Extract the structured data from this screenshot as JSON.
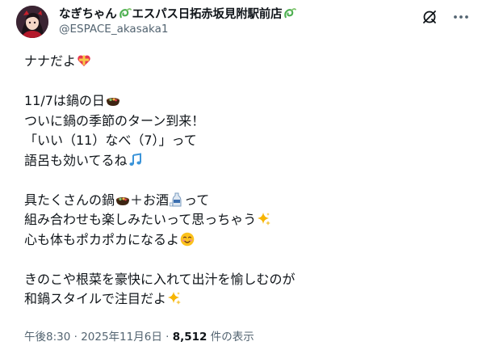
{
  "author": {
    "display_name": "なぎちゃん",
    "display_name_suffix": "エスパス日拓赤坂見附駅前店",
    "handle": "@ESPACE_akasaka1",
    "name_emoji": "seedling-swirl"
  },
  "post": {
    "lines": [
      {
        "text": "ナナだよ",
        "emoji": "heart-ribbon"
      },
      {
        "text": "",
        "emoji": ""
      },
      {
        "text": "11/7は鍋の日",
        "emoji": "hotpot"
      },
      {
        "text": "ついに鍋の季節のターン到来！",
        "emoji": ""
      },
      {
        "text": "「いい（11）なべ（7）」って",
        "emoji": ""
      },
      {
        "text": "語呂も効いてるね",
        "emoji": "music-notes"
      },
      {
        "text": "",
        "emoji": ""
      },
      {
        "text": "具たくさんの鍋",
        "emoji": "hotpot"
      },
      {
        "text": "組み合わせも楽しみたいって思っちゃう",
        "emoji": "sparkles"
      },
      {
        "text": "心も体もポカポカになるよ",
        "emoji": "smiling-face"
      },
      {
        "text": "",
        "emoji": ""
      },
      {
        "text": "きのこや根菜を豪快に入れて出汁を愉しむのが",
        "emoji": ""
      },
      {
        "text": "和鍋スタイルで注目だよ",
        "emoji": "sparkles"
      }
    ],
    "line7_mid_text": "＋お酒",
    "line7_end_text": "って"
  },
  "meta": {
    "time": "午後8:30",
    "sep1": " · ",
    "date": "2025年11月6日",
    "sep2": " · ",
    "views": "8,512",
    "views_suffix": " 件の表示"
  },
  "colors": {
    "text": "#0f1419",
    "secondary": "#536471",
    "accent": "#1d9bf0",
    "background": "#ffffff"
  }
}
